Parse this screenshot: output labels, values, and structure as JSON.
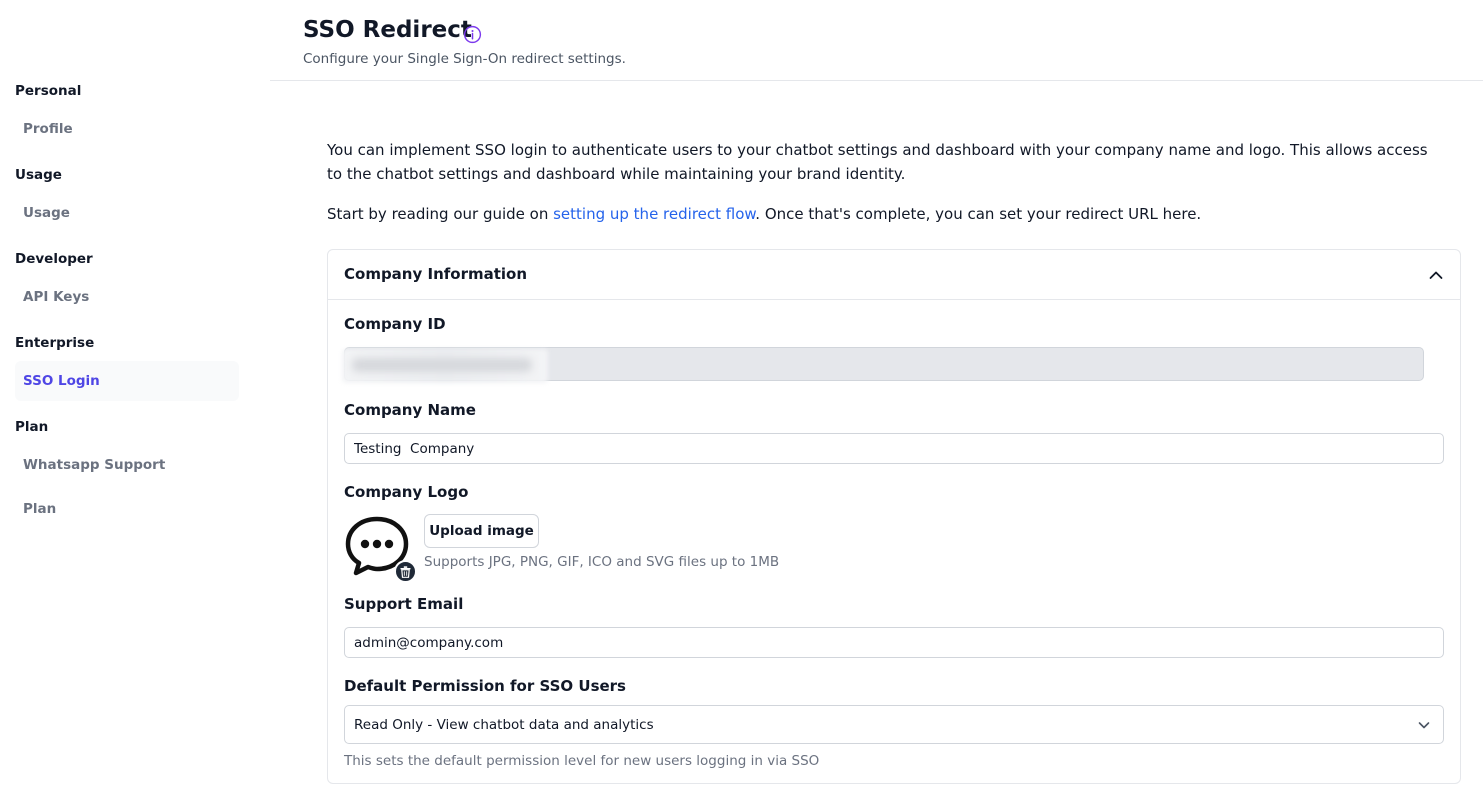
{
  "sidebar": {
    "sections": [
      {
        "title": "Personal",
        "items": [
          {
            "label": "Profile",
            "active": false
          }
        ]
      },
      {
        "title": "Usage",
        "items": [
          {
            "label": "Usage",
            "active": false
          }
        ]
      },
      {
        "title": "Developer",
        "items": [
          {
            "label": "API Keys",
            "active": false
          }
        ]
      },
      {
        "title": "Enterprise",
        "items": [
          {
            "label": "SSO Login",
            "active": true
          }
        ]
      },
      {
        "title": "Plan",
        "items": [
          {
            "label": "Whatsapp Support",
            "active": false
          },
          {
            "label": "Plan",
            "active": false
          }
        ]
      }
    ]
  },
  "header": {
    "title": "SSO Redirect",
    "subtitle": "Configure your Single Sign-On redirect settings.",
    "info_icon": "info-circle-icon"
  },
  "intro": {
    "paragraph": "You can implement SSO login to authenticate users to your chatbot settings and dashboard with your company name and logo. This allows access to the chatbot settings and dashboard while maintaining your brand identity.",
    "guide_prefix": "Start by reading our guide on ",
    "guide_link": "setting up the redirect flow",
    "guide_suffix": ". Once that's complete, you can set your redirect URL here."
  },
  "card": {
    "title": "Company Information",
    "collapse_icon": "chevron-up-icon",
    "company_id": {
      "label": "Company ID",
      "value": ""
    },
    "company_name": {
      "label": "Company Name",
      "value": "Testing  Company"
    },
    "company_logo": {
      "label": "Company Logo",
      "upload_label": "Upload image",
      "hint": "Supports JPG, PNG, GIF, ICO and SVG files up to 1MB",
      "logo_icon": "chat-bubble-icon",
      "delete_icon": "trash-icon"
    },
    "support_email": {
      "label": "Support Email",
      "value": "admin@company.com"
    },
    "default_permission": {
      "label": "Default Permission for SSO Users",
      "selected": "Read Only - View chatbot data and analytics",
      "help": "This sets the default permission level for new users logging in via SSO"
    }
  },
  "colors": {
    "accent": "#4f46e5",
    "link": "#2563eb",
    "muted_text": "#6b7280",
    "border": "#e5e7eb"
  }
}
